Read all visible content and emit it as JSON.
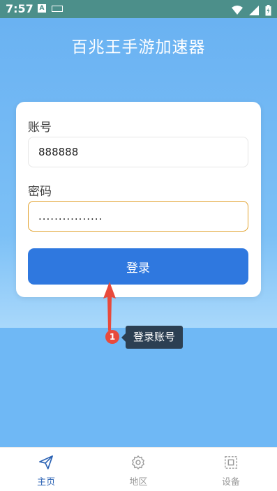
{
  "status_bar": {
    "time": "7:57",
    "notification_icon_label": "A"
  },
  "header": {
    "title": "百兆王手游加速器"
  },
  "login_form": {
    "account_label": "账号",
    "account_value": "888888",
    "password_label": "密码",
    "password_value": "................",
    "login_button": "登录"
  },
  "annotation": {
    "step_number": "1",
    "tooltip": "登录账号"
  },
  "bottom_nav": {
    "items": [
      {
        "label": "主页",
        "icon": "send-icon",
        "active": true
      },
      {
        "label": "地区",
        "icon": "gear-icon",
        "active": false
      },
      {
        "label": "设备",
        "icon": "device-icon",
        "active": false
      }
    ]
  },
  "colors": {
    "primary": "#2f78df",
    "background": "#6fb8f5",
    "accent_border": "#e2a22d",
    "annotation_red": "#e84a3c"
  }
}
